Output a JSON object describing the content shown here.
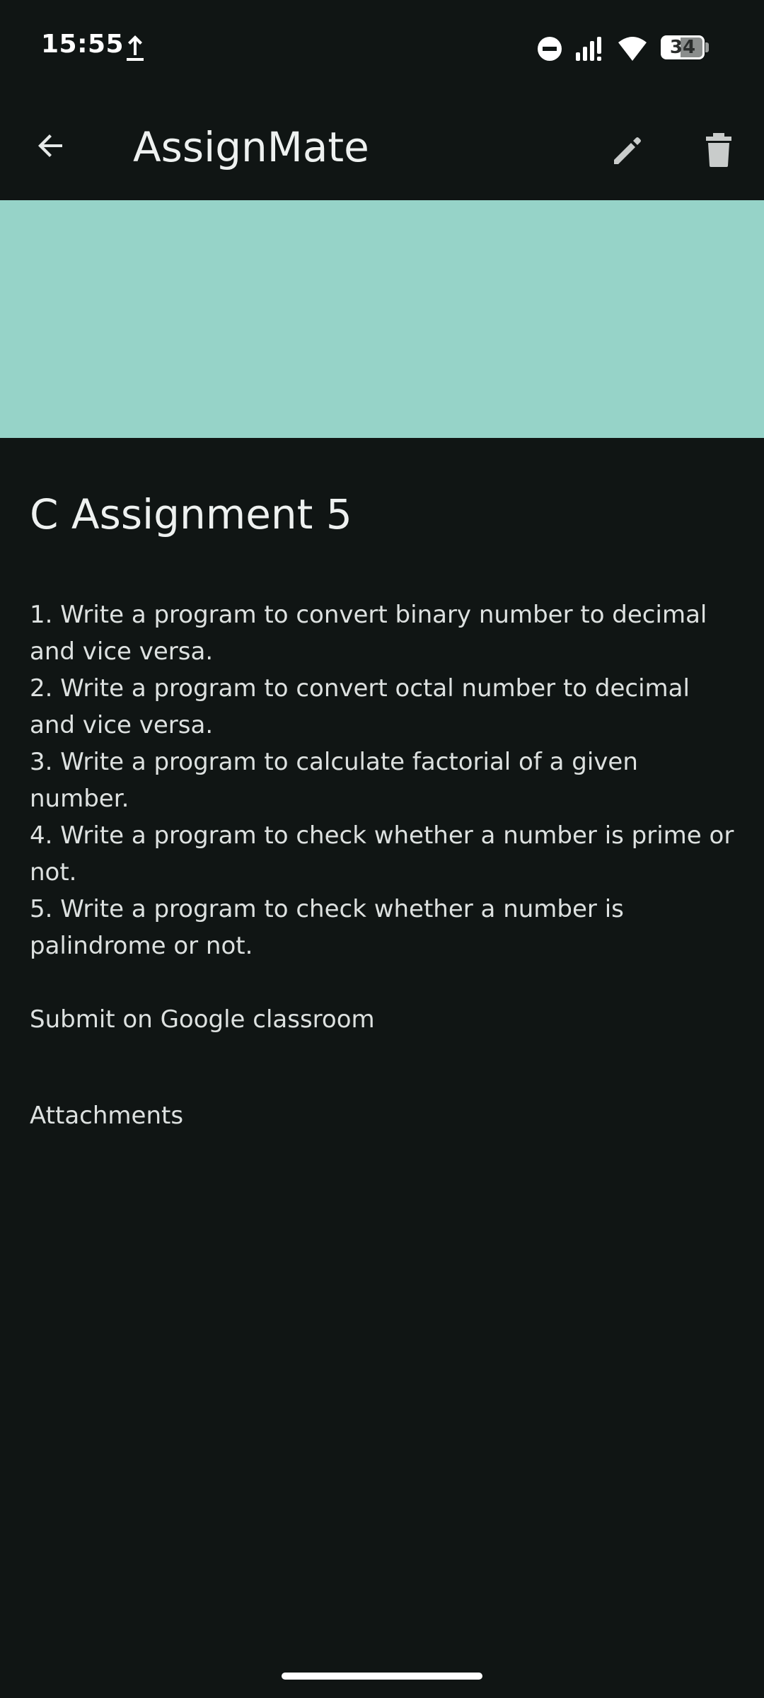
{
  "status_bar": {
    "time": "15:55",
    "battery_level": "34",
    "icons": [
      "upload-icon",
      "do-not-disturb-icon",
      "signal-icon",
      "wifi-icon",
      "battery-icon"
    ]
  },
  "app_bar": {
    "title": "AssignMate",
    "icons": [
      "back-arrow-icon",
      "edit-pencil-icon",
      "trash-icon"
    ]
  },
  "banner": {
    "color": "#96d3c8"
  },
  "assignment": {
    "title": "C Assignment 5",
    "description_lines": [
      "1. Write a program to convert binary number to decimal and vice versa.",
      "2. Write a program to convert octal number to decimal and vice versa.",
      "3. Write a program to calculate factorial of a given number.",
      "4. Write a program to check whether a number is prime or not.",
      "5. Write a program to check whether a number is palindrome or not."
    ],
    "submit_note": "Submit on Google classroom",
    "attachments_label": "Attachments"
  },
  "colors": {
    "background": "#101514",
    "text": "#e6e9e8",
    "accent": "#96d3c8"
  }
}
